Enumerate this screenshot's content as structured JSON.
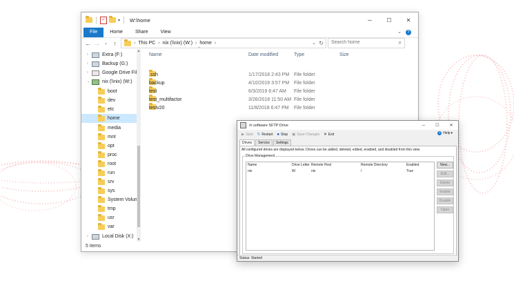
{
  "explorer": {
    "title": "W:\\home",
    "window_buttons": {
      "minimize": "─",
      "maximize": "☐",
      "close": "✕"
    },
    "ribbon_tabs": [
      {
        "label": "File",
        "active": true
      },
      {
        "label": "Home"
      },
      {
        "label": "Share"
      },
      {
        "label": "View"
      }
    ],
    "address": {
      "crumbs": [
        "This PC",
        "nix (\\\\nix) (W:)",
        "home"
      ]
    },
    "search": {
      "placeholder": "Search home"
    },
    "columns": [
      "Name",
      "Date modified",
      "Type",
      "Size"
    ],
    "nav_items": [
      {
        "label": "Extra (F:)",
        "icon": "drive-icon"
      },
      {
        "label": "Backup (G:)",
        "icon": "drive-icon"
      },
      {
        "label": "Google Drive File",
        "icon": "google-drive-icon"
      },
      {
        "label": "nix (\\\\nix) (W:)",
        "icon": "network-drive-icon"
      },
      {
        "label": "boot",
        "icon": "folder-icon"
      },
      {
        "label": "dev",
        "icon": "folder-icon"
      },
      {
        "label": "etc",
        "icon": "folder-icon"
      },
      {
        "label": "home",
        "icon": "folder-icon",
        "selected": true
      },
      {
        "label": "media",
        "icon": "folder-icon"
      },
      {
        "label": "mnt",
        "icon": "folder-icon"
      },
      {
        "label": "opt",
        "icon": "folder-icon"
      },
      {
        "label": "proc",
        "icon": "folder-icon"
      },
      {
        "label": "root",
        "icon": "folder-icon"
      },
      {
        "label": "run",
        "icon": "folder-icon"
      },
      {
        "label": "srv",
        "icon": "folder-icon"
      },
      {
        "label": "sys",
        "icon": "folder-icon"
      },
      {
        "label": "System Volume",
        "icon": "folder-icon"
      },
      {
        "label": "tmp",
        "icon": "folder-icon"
      },
      {
        "label": "usr",
        "icon": "folder-icon"
      },
      {
        "label": "var",
        "icon": "folder-icon"
      },
      {
        "label": "Local Disk (X:)",
        "icon": "drive-icon"
      }
    ],
    "files": [
      {
        "name": ".ssh",
        "date": "1/17/2018 2:43 PM",
        "type": "File folder"
      },
      {
        "name": "backup",
        "date": "4/10/2019 3:57 PM",
        "type": "File folder"
      },
      {
        "name": "test",
        "date": "6/3/2019 6:47 AM",
        "type": "File folder"
      },
      {
        "name": "test_multifactor",
        "date": "3/26/2018 11:50 AM",
        "type": "File folder"
      },
      {
        "name": "testv20",
        "date": "11/8/2018 6:47 PM",
        "type": "File folder"
      }
    ],
    "status": "5 items"
  },
  "sftp": {
    "title": "/n software SFTP Drive",
    "toolbar": {
      "start": "Start",
      "restart": "Restart",
      "stop": "Stop",
      "save": "Save Changes",
      "exit": "Exit",
      "help": "Help"
    },
    "tabs": [
      {
        "label": "Drives",
        "active": true
      },
      {
        "label": "Service"
      },
      {
        "label": "Settings"
      }
    ],
    "description": "All configured drives are displayed below. Drives can be added, deleted, edited, enabled, and disabled from this view.",
    "group_label": "Drive Management",
    "columns": [
      "Name",
      "Drive Letter",
      "Remote Host",
      "Remote Directory",
      "Enabled"
    ],
    "rows": [
      {
        "name": "nix",
        "letter": "W:",
        "host": "nix",
        "dir": "/",
        "enabled": "True"
      }
    ],
    "buttons": {
      "new": "New...",
      "edit": "Edit...",
      "delete": "Delete",
      "enable": "Enable",
      "disable": "Disable",
      "open": "Open"
    },
    "status": "Status: Started"
  }
}
